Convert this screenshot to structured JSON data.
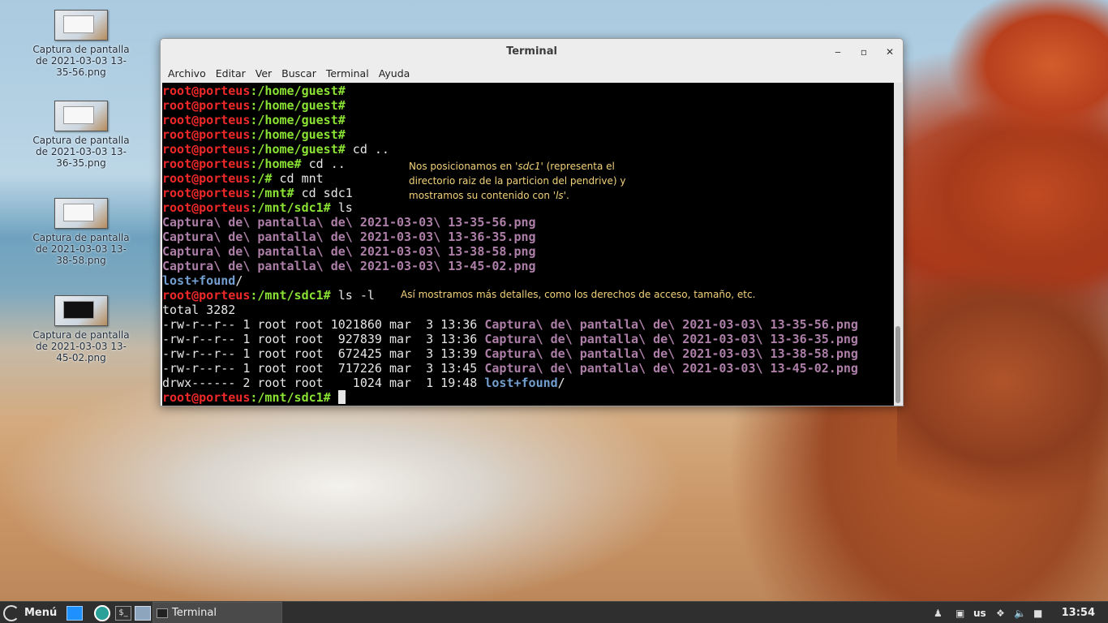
{
  "desktop": {
    "icons": [
      {
        "label": "Captura de pantalla de 2021-03-03 13-35-56.png",
        "dark": false
      },
      {
        "label": "Captura de pantalla de 2021-03-03 13-36-35.png",
        "dark": false
      },
      {
        "label": "Captura de pantalla de 2021-03-03 13-38-58.png",
        "dark": false
      },
      {
        "label": "Captura de pantalla de 2021-03-03 13-45-02.png",
        "dark": true
      }
    ]
  },
  "window": {
    "title": "Terminal",
    "controls": {
      "minimize": "‒",
      "maximize": "▫",
      "close": "✕"
    },
    "menu": [
      "Archivo",
      "Editar",
      "Ver",
      "Buscar",
      "Terminal",
      "Ayuda"
    ]
  },
  "terminal": {
    "user": "root@porteus",
    "lines": [
      {
        "kind": "prompt",
        "path": "/home/guest#",
        "cmd": ""
      },
      {
        "kind": "prompt",
        "path": "/home/guest#",
        "cmd": ""
      },
      {
        "kind": "prompt",
        "path": "/home/guest#",
        "cmd": ""
      },
      {
        "kind": "prompt",
        "path": "/home/guest#",
        "cmd": ""
      },
      {
        "kind": "prompt",
        "path": "/home/guest#",
        "cmd": " cd .."
      },
      {
        "kind": "prompt",
        "path": "/home#",
        "cmd": " cd .."
      },
      {
        "kind": "prompt",
        "path": "/#",
        "cmd": " cd mnt"
      },
      {
        "kind": "prompt",
        "path": "/mnt#",
        "cmd": " cd sdc1"
      },
      {
        "kind": "prompt",
        "path": "/mnt/sdc1#",
        "cmd": " ls"
      },
      {
        "kind": "file",
        "text": "Captura\\ de\\ pantalla\\ de\\ 2021-03-03\\ 13-35-56.png"
      },
      {
        "kind": "file",
        "text": "Captura\\ de\\ pantalla\\ de\\ 2021-03-03\\ 13-36-35.png"
      },
      {
        "kind": "file",
        "text": "Captura\\ de\\ pantalla\\ de\\ 2021-03-03\\ 13-38-58.png"
      },
      {
        "kind": "file",
        "text": "Captura\\ de\\ pantalla\\ de\\ 2021-03-03\\ 13-45-02.png"
      },
      {
        "kind": "dir",
        "text": "lost+found",
        "suffix": "/"
      },
      {
        "kind": "prompt",
        "path": "/mnt/sdc1#",
        "cmd": " ls -l"
      },
      {
        "kind": "plain",
        "text": "total 3282"
      },
      {
        "kind": "long",
        "meta": "-rw-r--r-- 1 root root 1021860 mar  3 13:36 ",
        "name": "Captura\\ de\\ pantalla\\ de\\ 2021-03-03\\ 13-35-56.png"
      },
      {
        "kind": "long",
        "meta": "-rw-r--r-- 1 root root  927839 mar  3 13:36 ",
        "name": "Captura\\ de\\ pantalla\\ de\\ 2021-03-03\\ 13-36-35.png"
      },
      {
        "kind": "long",
        "meta": "-rw-r--r-- 1 root root  672425 mar  3 13:39 ",
        "name": "Captura\\ de\\ pantalla\\ de\\ 2021-03-03\\ 13-38-58.png"
      },
      {
        "kind": "long",
        "meta": "-rw-r--r-- 1 root root  717226 mar  3 13:45 ",
        "name": "Captura\\ de\\ pantalla\\ de\\ 2021-03-03\\ 13-45-02.png"
      },
      {
        "kind": "longdir",
        "meta": "drwx------ 2 root root    1024 mar  1 19:48 ",
        "name": "lost+found",
        "suffix": "/"
      },
      {
        "kind": "prompt",
        "path": "/mnt/sdc1#",
        "cmd": " ",
        "cursor": true
      }
    ],
    "notes": {
      "note1_a": "Nos posicionamos en '",
      "note1_b": "sdc1",
      "note1_c": "' (representa el directorio raiz de la particion del pendrive) y mostramos su contenido con '",
      "note1_d": "ls",
      "note1_e": "'.",
      "note2": "Así mostramos más detalles, como los derechos de acceso, tamaño, etc."
    }
  },
  "taskbar": {
    "menu_label": "Menú",
    "task_label": "Terminal",
    "keyboard_layout": "us",
    "clock": "13:54"
  },
  "colors": {
    "prompt_user": "#ef2929",
    "prompt_path": "#8ae234",
    "file": "#ad7fa8",
    "directory": "#729fcf",
    "annotation": "#f2d27a"
  }
}
